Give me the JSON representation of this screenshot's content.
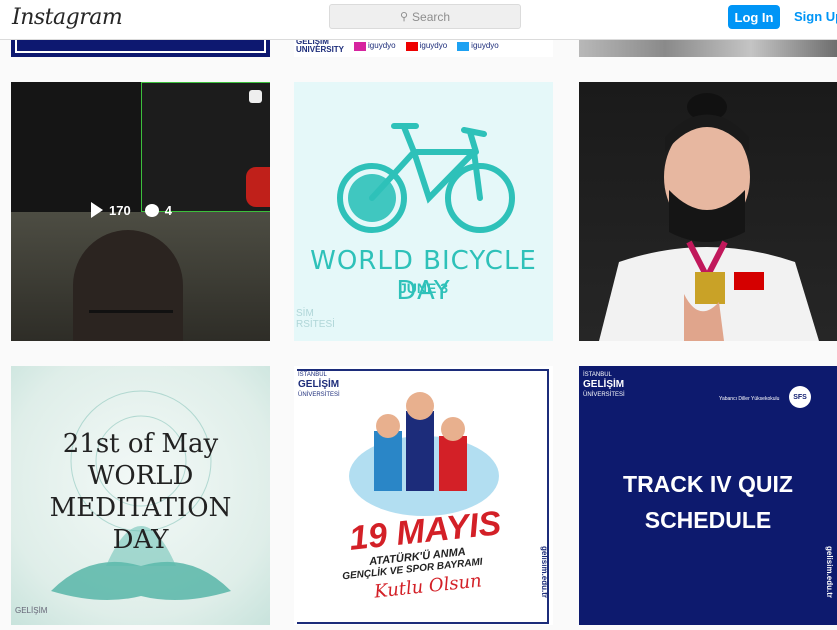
{
  "header": {
    "logo": "Instagram",
    "search_placeholder": "Search",
    "search_icon": "search-icon",
    "login_label": "Log In",
    "signup_label": "Sign Up"
  },
  "top_row": {
    "post2": {
      "brand_line1": "GELİŞİM",
      "brand_line2": "UNIVERSITY",
      "instagram": "iguydyo",
      "youtube": "iguydyo",
      "twitter": "iguydyo"
    }
  },
  "video_post": {
    "views": "170",
    "comments": "4",
    "view_icon": "play-icon",
    "comment_icon": "comment-icon",
    "reel_icon": "reel-icon"
  },
  "bike_post": {
    "title": "WORLD BICYCLE DAY",
    "date": "JUNE 3",
    "brand": "SİM\nRSİTESİ"
  },
  "meditation_post": {
    "line1": "21st of May",
    "line2": "WORLD",
    "line3": "MEDITATION",
    "line4": "DAY",
    "brand": "GELİŞİM"
  },
  "ataturk_post": {
    "uni_small": "İSTANBUL",
    "uni_name": "GELİŞİM",
    "uni_sub": "ÜNİVERSİTESİ",
    "big": "19 MAYIS",
    "line1": "ATATÜRK'Ü ANMA",
    "line2": "GENÇLİK VE SPOR BAYRAMI",
    "line3": "Kutlu Olsun",
    "site": "gelisim.edu.tr"
  },
  "quiz_post": {
    "uni_small": "İSTANBUL",
    "uni_name": "GELİŞİM",
    "uni_sub": "ÜNİVERSİTESİ",
    "school": "Yabancı Diller Yüksekokulu",
    "badge": "SFS",
    "title_line1": "TRACK IV QUIZ",
    "title_line2": "SCHEDULE",
    "site": "gelisim.edu.tr"
  },
  "colors": {
    "accent": "#0095f6",
    "navy": "#0d1a6e",
    "teal": "#2ec1b9",
    "red": "#d32027"
  }
}
